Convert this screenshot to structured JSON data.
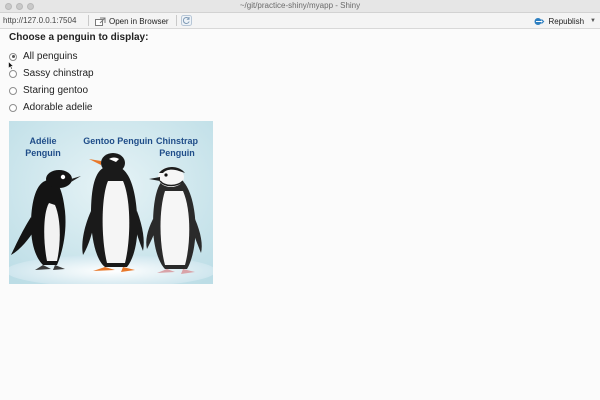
{
  "window": {
    "title": "~/git/practice-shiny/myapp - Shiny"
  },
  "toolbar": {
    "url": "http://127.0.0.1:7504",
    "open_browser_label": "Open in Browser",
    "republish_label": "Republish",
    "icons": {
      "open_browser": "open-in-browser-icon",
      "refresh": "refresh-icon",
      "republish": "republish-icon"
    }
  },
  "main": {
    "prompt": "Choose a penguin to display:",
    "options": [
      {
        "label": "All penguins",
        "selected": true
      },
      {
        "label": "Sassy chinstrap",
        "selected": false
      },
      {
        "label": "Staring gentoo",
        "selected": false
      },
      {
        "label": "Adorable adelie",
        "selected": false
      }
    ],
    "image": {
      "labels": {
        "adelie_line1": "Adélie",
        "adelie_line2": "Penguin",
        "gentoo": "Gentoo Penguin",
        "chinstrap_line1": "Chinstrap",
        "chinstrap_line2": "Penguin"
      }
    }
  },
  "colors": {
    "accent": "#2d7fc1",
    "label_blue": "#1f4d89",
    "image_background": "#cfe7ee"
  }
}
